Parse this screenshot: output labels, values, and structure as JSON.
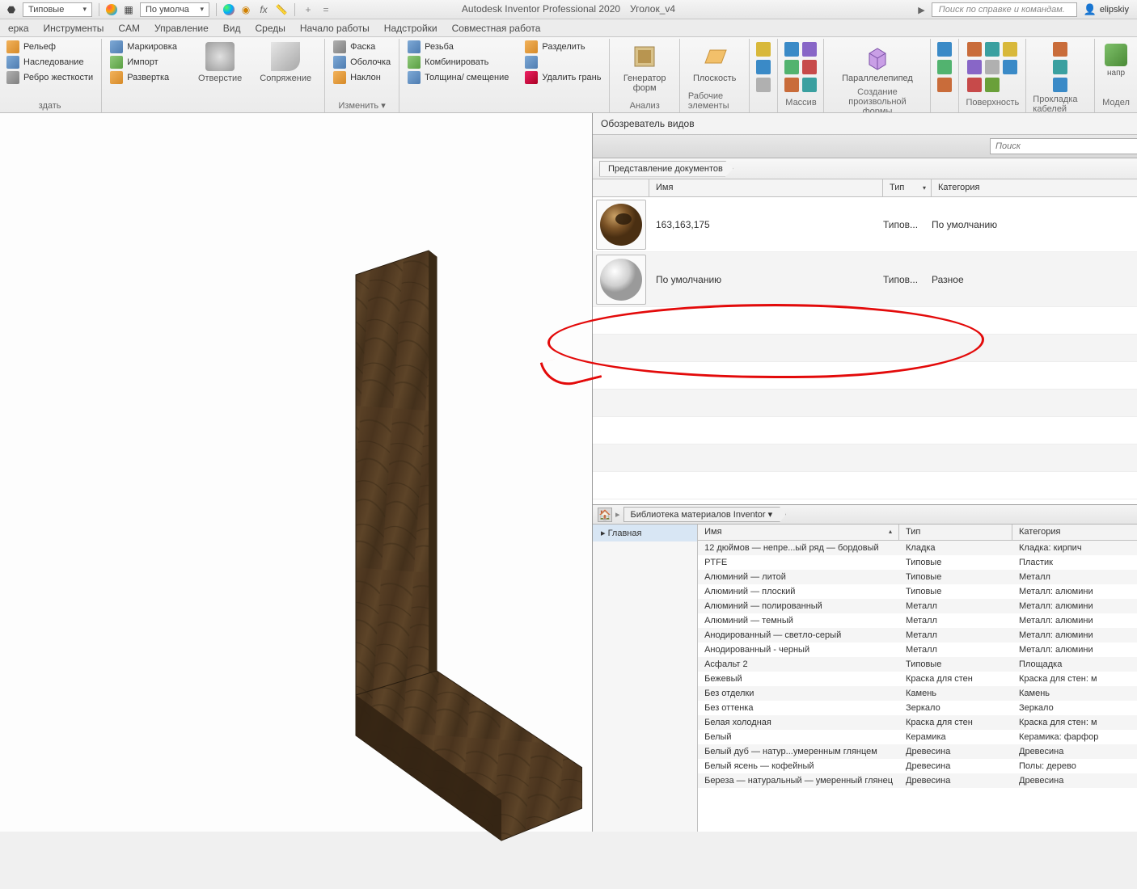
{
  "app_title": "Autodesk Inventor Professional 2020",
  "doc_title": "Уголок_v4",
  "qat": {
    "material_combo": "Типовые",
    "appearance_combo": "По умолча",
    "search_placeholder": "Поиск по справке и командам.",
    "user": "elipskiy"
  },
  "menus": [
    "ерка",
    "Инструменты",
    "CAM",
    "Управление",
    "Вид",
    "Среды",
    "Начало работы",
    "Надстройки",
    "Совместная работа"
  ],
  "ribbon": {
    "modify": {
      "relief": "Рельеф",
      "markup": "Маркировка",
      "inherit": "Наследование",
      "import": "Импорт",
      "rib": "Ребро жесткости",
      "unfold": "Развертка",
      "create_label": "здать"
    },
    "hole": "Отверстие",
    "fillet": "Сопряжение",
    "chamfer": "Фаска",
    "thread": "Резьба",
    "shell": "Оболочка",
    "combine": "Комбинировать",
    "draft": "Наклон",
    "thicken": "Толщина/ смещение",
    "split": "Разделить",
    "delete_face": "Удалить грань",
    "modify_label": "Изменить ▾",
    "form_gen": "Генератор форм",
    "analysis": "Анализ",
    "plane": "Плоскость",
    "work_feat": "Рабочие элементы",
    "pattern": "Массив",
    "box": "Параллелепипед",
    "freeform": "Создание произвольной формы",
    "surface": "Поверхность",
    "cable": "Прокладка кабелей",
    "model": "Модел",
    "dir": "напр"
  },
  "panel": {
    "title": "Обозреватель видов",
    "search_placeholder": "Поиск",
    "crumb": "Представление документов",
    "headers": {
      "name": "Имя",
      "type": "Тип",
      "category": "Категория"
    },
    "rows": [
      {
        "name": "163,163,175",
        "type": "Типов...",
        "category": "По умолчанию",
        "thumb": "wood"
      },
      {
        "name": "По умолчанию",
        "type": "Типов...",
        "category": "Разное",
        "thumb": "sphere"
      }
    ]
  },
  "library": {
    "crumb": "Библиотека материалов Inventor",
    "side_item": "Главная",
    "headers": {
      "name": "Имя",
      "type": "Тип",
      "category": "Категория"
    },
    "rows": [
      {
        "n": "12 дюймов — непре...ый ряд — бордовый",
        "t": "Кладка",
        "c": "Кладка: кирпич"
      },
      {
        "n": "PTFE",
        "t": "Типовые",
        "c": "Пластик"
      },
      {
        "n": "Алюминий — литой",
        "t": "Типовые",
        "c": "Металл"
      },
      {
        "n": "Алюминий — плоский",
        "t": "Типовые",
        "c": "Металл: алюмини"
      },
      {
        "n": "Алюминий — полированный",
        "t": "Металл",
        "c": "Металл: алюмини"
      },
      {
        "n": "Алюминий — темный",
        "t": "Металл",
        "c": "Металл: алюмини"
      },
      {
        "n": "Анодированный — светло-серый",
        "t": "Металл",
        "c": "Металл: алюмини"
      },
      {
        "n": "Анодированный - черный",
        "t": "Металл",
        "c": "Металл: алюмини"
      },
      {
        "n": "Асфальт 2",
        "t": "Типовые",
        "c": "Площадка"
      },
      {
        "n": "Бежевый",
        "t": "Краска для стен",
        "c": "Краска для стен: м"
      },
      {
        "n": "Без отделки",
        "t": "Камень",
        "c": "Камень"
      },
      {
        "n": "Без оттенка",
        "t": "Зеркало",
        "c": "Зеркало"
      },
      {
        "n": "Белая холодная",
        "t": "Краска для стен",
        "c": "Краска для стен: м"
      },
      {
        "n": "Белый",
        "t": "Керамика",
        "c": "Керамика: фарфор"
      },
      {
        "n": "Белый дуб — натур...умеренным глянцем",
        "t": "Древесина",
        "c": "Древесина"
      },
      {
        "n": "Белый ясень — кофейный",
        "t": "Древесина",
        "c": "Полы: дерево"
      },
      {
        "n": "Береза — натуральный — умеренный глянец",
        "t": "Древесина",
        "c": "Древесина"
      }
    ]
  }
}
